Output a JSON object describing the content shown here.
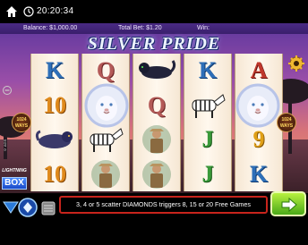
{
  "status": {
    "time": "20:20:34"
  },
  "info": {
    "balance_label": "Balance: $1,000.00",
    "bet_label": "Total Bet: $1.20",
    "win_label": "Win:"
  },
  "game": {
    "title": "SILVER PRIDE",
    "ways_label_left": "1024 WAYS",
    "ways_label_right": "1024 WAYS",
    "side_text": "© AGS"
  },
  "reels": [
    [
      "K",
      "10",
      "",
      "10"
    ],
    [
      "Q",
      "",
      "",
      ""
    ],
    [
      "",
      "Q",
      "",
      ""
    ],
    [
      "K",
      "",
      "J",
      "J"
    ],
    [
      "A",
      "",
      "9",
      "K"
    ]
  ],
  "lightning": {
    "top": "LIGHTNING",
    "box": "BOX"
  },
  "message": "3, 4 or 5 scatter DIAMONDS triggers 8, 15 or 20 Free Games",
  "colors": {
    "accent": "#c8241c",
    "spin": "#4aa818",
    "info_bar": "#4a2a84"
  }
}
